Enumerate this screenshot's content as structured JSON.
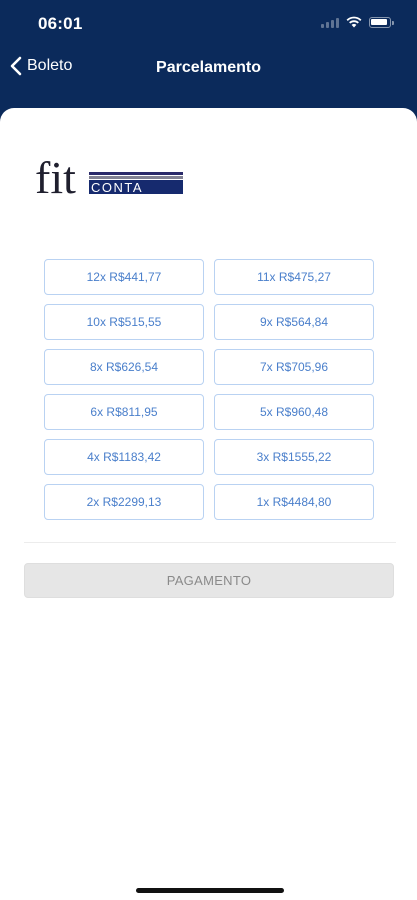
{
  "status_bar": {
    "time": "06:01"
  },
  "nav": {
    "back_label": "Boleto",
    "title": "Parcelamento"
  },
  "logo": {
    "text_left": "fit",
    "text_right": "CONTA"
  },
  "installments": [
    "12x R$441,77",
    "11x R$475,27",
    "10x R$515,55",
    "9x R$564,84",
    "8x R$626,54",
    "7x R$705,96",
    "6x R$811,95",
    "5x R$960,48",
    "4x R$1183,42",
    "3x R$1555,22",
    "2x R$2299,13",
    "1x R$4484,80"
  ],
  "payment_button": {
    "label": "PAGAMENTO"
  },
  "colors": {
    "header_bg": "#0b2a5b",
    "installment_text": "#4a7fcb",
    "installment_border": "#b9d2f2",
    "button_disabled_bg": "#e6e6e6"
  }
}
